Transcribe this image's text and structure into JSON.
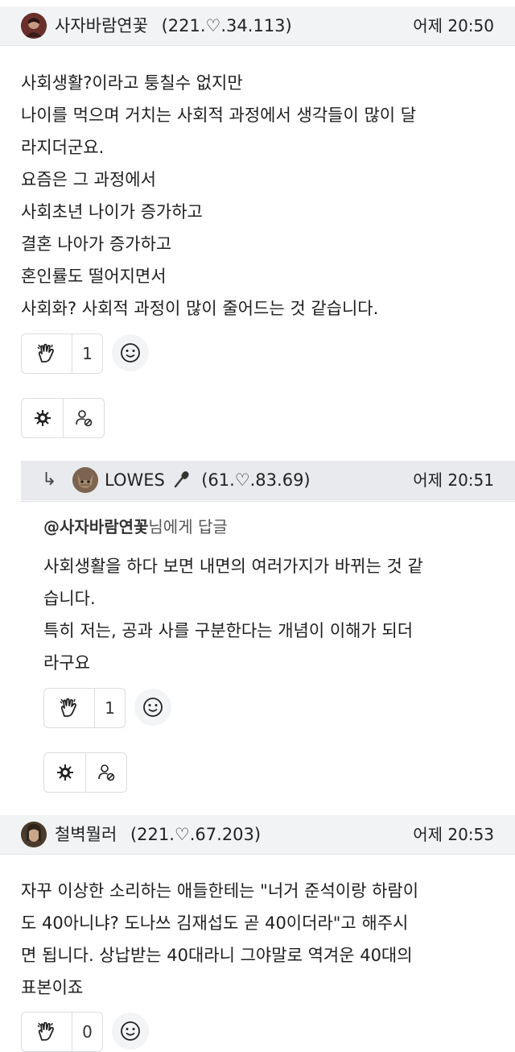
{
  "comments": [
    {
      "nick": "사자바람연꽃",
      "ip": "(221.♡.34.113)",
      "time": "어제 20:50",
      "lines": [
        "사회생활?이라고 퉁칠수 없지만",
        "나이를 먹으며 거치는 사회적 과정에서 생각들이 많이 달",
        "라지더군요.",
        "요즘은 그 과정에서",
        "사회초년 나이가 증가하고",
        "결혼 나아가 증가하고",
        "혼인률도 떨어지면서",
        "사회화? 사회적 과정이 많이 줄어드는 것 같습니다."
      ],
      "likes": "1"
    },
    {
      "reply_arrow": "↳",
      "nick": "LOWES",
      "nick_icon": "microphone-icon",
      "ip": "(61.♡.83.69)",
      "time": "어제 20:51",
      "mention_name": "@사자바람연꽃",
      "mention_suffix": "님에게 답글",
      "lines": [
        "사회생활을 하다 보면 내면의 여러가지가 바뀌는 것 같",
        "습니다.",
        "특히 저는, 공과 사를 구분한다는 개념이 이해가 되더",
        "라구요"
      ],
      "likes": "1"
    },
    {
      "nick": "철벽뭘러",
      "ip": "(221.♡.67.203)",
      "time": "어제 20:53",
      "lines": [
        "자꾸 이상한 소리하는 애들한테는 \"너거 준석이랑 하람이",
        "도 40아니냐? 도나쓰 김재섭도 곧 40이더라\"고 해주시",
        "면 됩니다. 상납받는 40대라니 그야말로 역겨운 40대의",
        "표본이죠"
      ],
      "likes": "0"
    }
  ]
}
